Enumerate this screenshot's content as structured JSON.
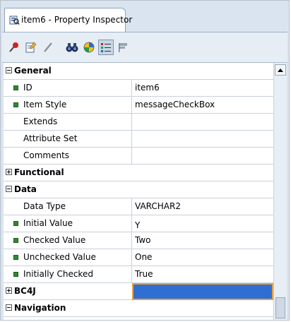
{
  "window": {
    "tab_title": "item6 - Property Inspector"
  },
  "toolbar": {
    "buttons": [
      {
        "name": "pin-icon"
      },
      {
        "name": "edit-properties-icon"
      },
      {
        "name": "pencil-icon"
      },
      {
        "name": "find-binoculars-icon"
      },
      {
        "name": "color-sphere-icon"
      },
      {
        "name": "categorized-view-icon",
        "selected": true
      },
      {
        "name": "flag-icon"
      }
    ]
  },
  "properties": {
    "general": {
      "label": "General",
      "expanded": true
    },
    "id": {
      "name": "ID",
      "value": "item6"
    },
    "item_style": {
      "name": "Item Style",
      "value": "messageCheckBox"
    },
    "extends": {
      "name": "Extends",
      "value": ""
    },
    "attribute_set": {
      "name": "Attribute Set",
      "value": ""
    },
    "comments": {
      "name": "Comments",
      "value": ""
    },
    "functional": {
      "label": "Functional",
      "expanded": false
    },
    "data": {
      "label": "Data",
      "expanded": true
    },
    "data_type": {
      "name": "Data Type",
      "value": "VARCHAR2"
    },
    "initial_value": {
      "name": "Initial Value",
      "value": "Y"
    },
    "checked_value": {
      "name": "Checked Value",
      "value": "Two"
    },
    "unchecked_value": {
      "name": "Unchecked Value",
      "value": "One"
    },
    "initially_checked": {
      "name": "Initially Checked",
      "value": "True"
    },
    "bc4j": {
      "label": "BC4J",
      "expanded": false
    },
    "navigation": {
      "label": "Navigation",
      "expanded": true
    }
  },
  "colors": {
    "bullet": "#2e8b2e",
    "selection": "#2f6fd1",
    "focus_border": "#e8a040"
  }
}
